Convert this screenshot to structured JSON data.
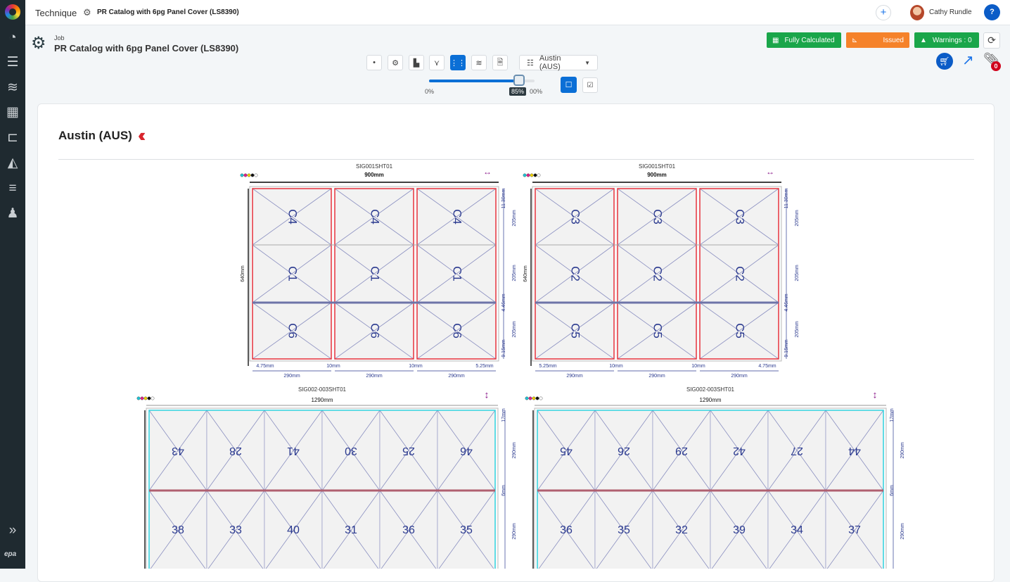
{
  "app": {
    "name": "Technique",
    "breadcrumb": "PR Catalog with 6pg Panel Cover (LS8390)"
  },
  "user": {
    "name": "Cathy Rundle"
  },
  "sidebar": {
    "items": [
      {
        "icon": "dashboard-icon"
      },
      {
        "icon": "list-columns-icon"
      },
      {
        "icon": "layers-icon"
      },
      {
        "icon": "calendar-icon"
      },
      {
        "icon": "gantt-icon"
      },
      {
        "icon": "area-chart-icon"
      },
      {
        "icon": "add-list-icon"
      },
      {
        "icon": "user-share-icon"
      }
    ],
    "expand_icon": "chevrons-right-icon",
    "footer_logo": "epa"
  },
  "job": {
    "label": "Job",
    "title": "PR Catalog with 6pg Panel Cover (LS8390)"
  },
  "status": {
    "calculated": "Fully Calculated",
    "issued": "Issued",
    "warnings": "Warnings : 0",
    "colors": {
      "green": "#1aa64a",
      "orange": "#f5822a"
    }
  },
  "attachments_count": "0",
  "toolbar": {
    "location_select": "Austin (AUS)",
    "zoom_min": "0%",
    "zoom_max": "00%",
    "zoom_value": "85%",
    "zoom_level": 85
  },
  "section": {
    "title": "Austin (AUS)"
  },
  "sheets": [
    {
      "name": "SIG001SHT01",
      "width": "900mm",
      "height": "640mm",
      "border": "#e8333c",
      "cells": [
        [
          "C4",
          "C4",
          "C4"
        ],
        [
          "C1",
          "C1",
          "C1"
        ],
        [
          "C6",
          "C6",
          "C6"
        ]
      ],
      "right_dims": [
        "11.30mm",
        "205mm",
        "205mm",
        "4.46mm",
        "205mm",
        "9.15mm"
      ],
      "bottom_gaps": [
        "4.75mm",
        "10mm",
        "10mm",
        "5.25mm"
      ],
      "bottom_widths": [
        "290mm",
        "290mm",
        "290mm"
      ]
    },
    {
      "name": "SIG001SHT01",
      "width": "900mm",
      "height": "640mm",
      "border": "#e8333c",
      "cells": [
        [
          "C3",
          "C3",
          "C3"
        ],
        [
          "C2",
          "C2",
          "C2"
        ],
        [
          "C5",
          "C5",
          "C5"
        ]
      ],
      "right_dims": [
        "11.30mm",
        "205mm",
        "205mm",
        "4.46mm",
        "205mm",
        "9.15mm"
      ],
      "bottom_gaps": [
        "5.25mm",
        "10mm",
        "10mm",
        "4.75mm"
      ],
      "bottom_widths": [
        "290mm",
        "290mm",
        "290mm"
      ]
    },
    {
      "name": "SIG002-003SHT01",
      "width": "1290mm",
      "border": "#2fd3e0",
      "cells": [
        [
          "43",
          "28",
          "41",
          "30",
          "25",
          "46"
        ],
        [
          "38",
          "33",
          "40",
          "31",
          "36",
          "35"
        ]
      ],
      "right_dims": [
        "17mm",
        "290mm",
        "6mm",
        "290mm"
      ]
    },
    {
      "name": "SIG002-003SHT01",
      "width": "1290mm",
      "border": "#2fd3e0",
      "cells": [
        [
          "45",
          "26",
          "29",
          "42",
          "27",
          "44"
        ],
        [
          "36",
          "35",
          "32",
          "39",
          "34",
          "37"
        ]
      ],
      "right_dims": [
        "17mm",
        "290mm",
        "6mm",
        "290mm"
      ]
    }
  ]
}
